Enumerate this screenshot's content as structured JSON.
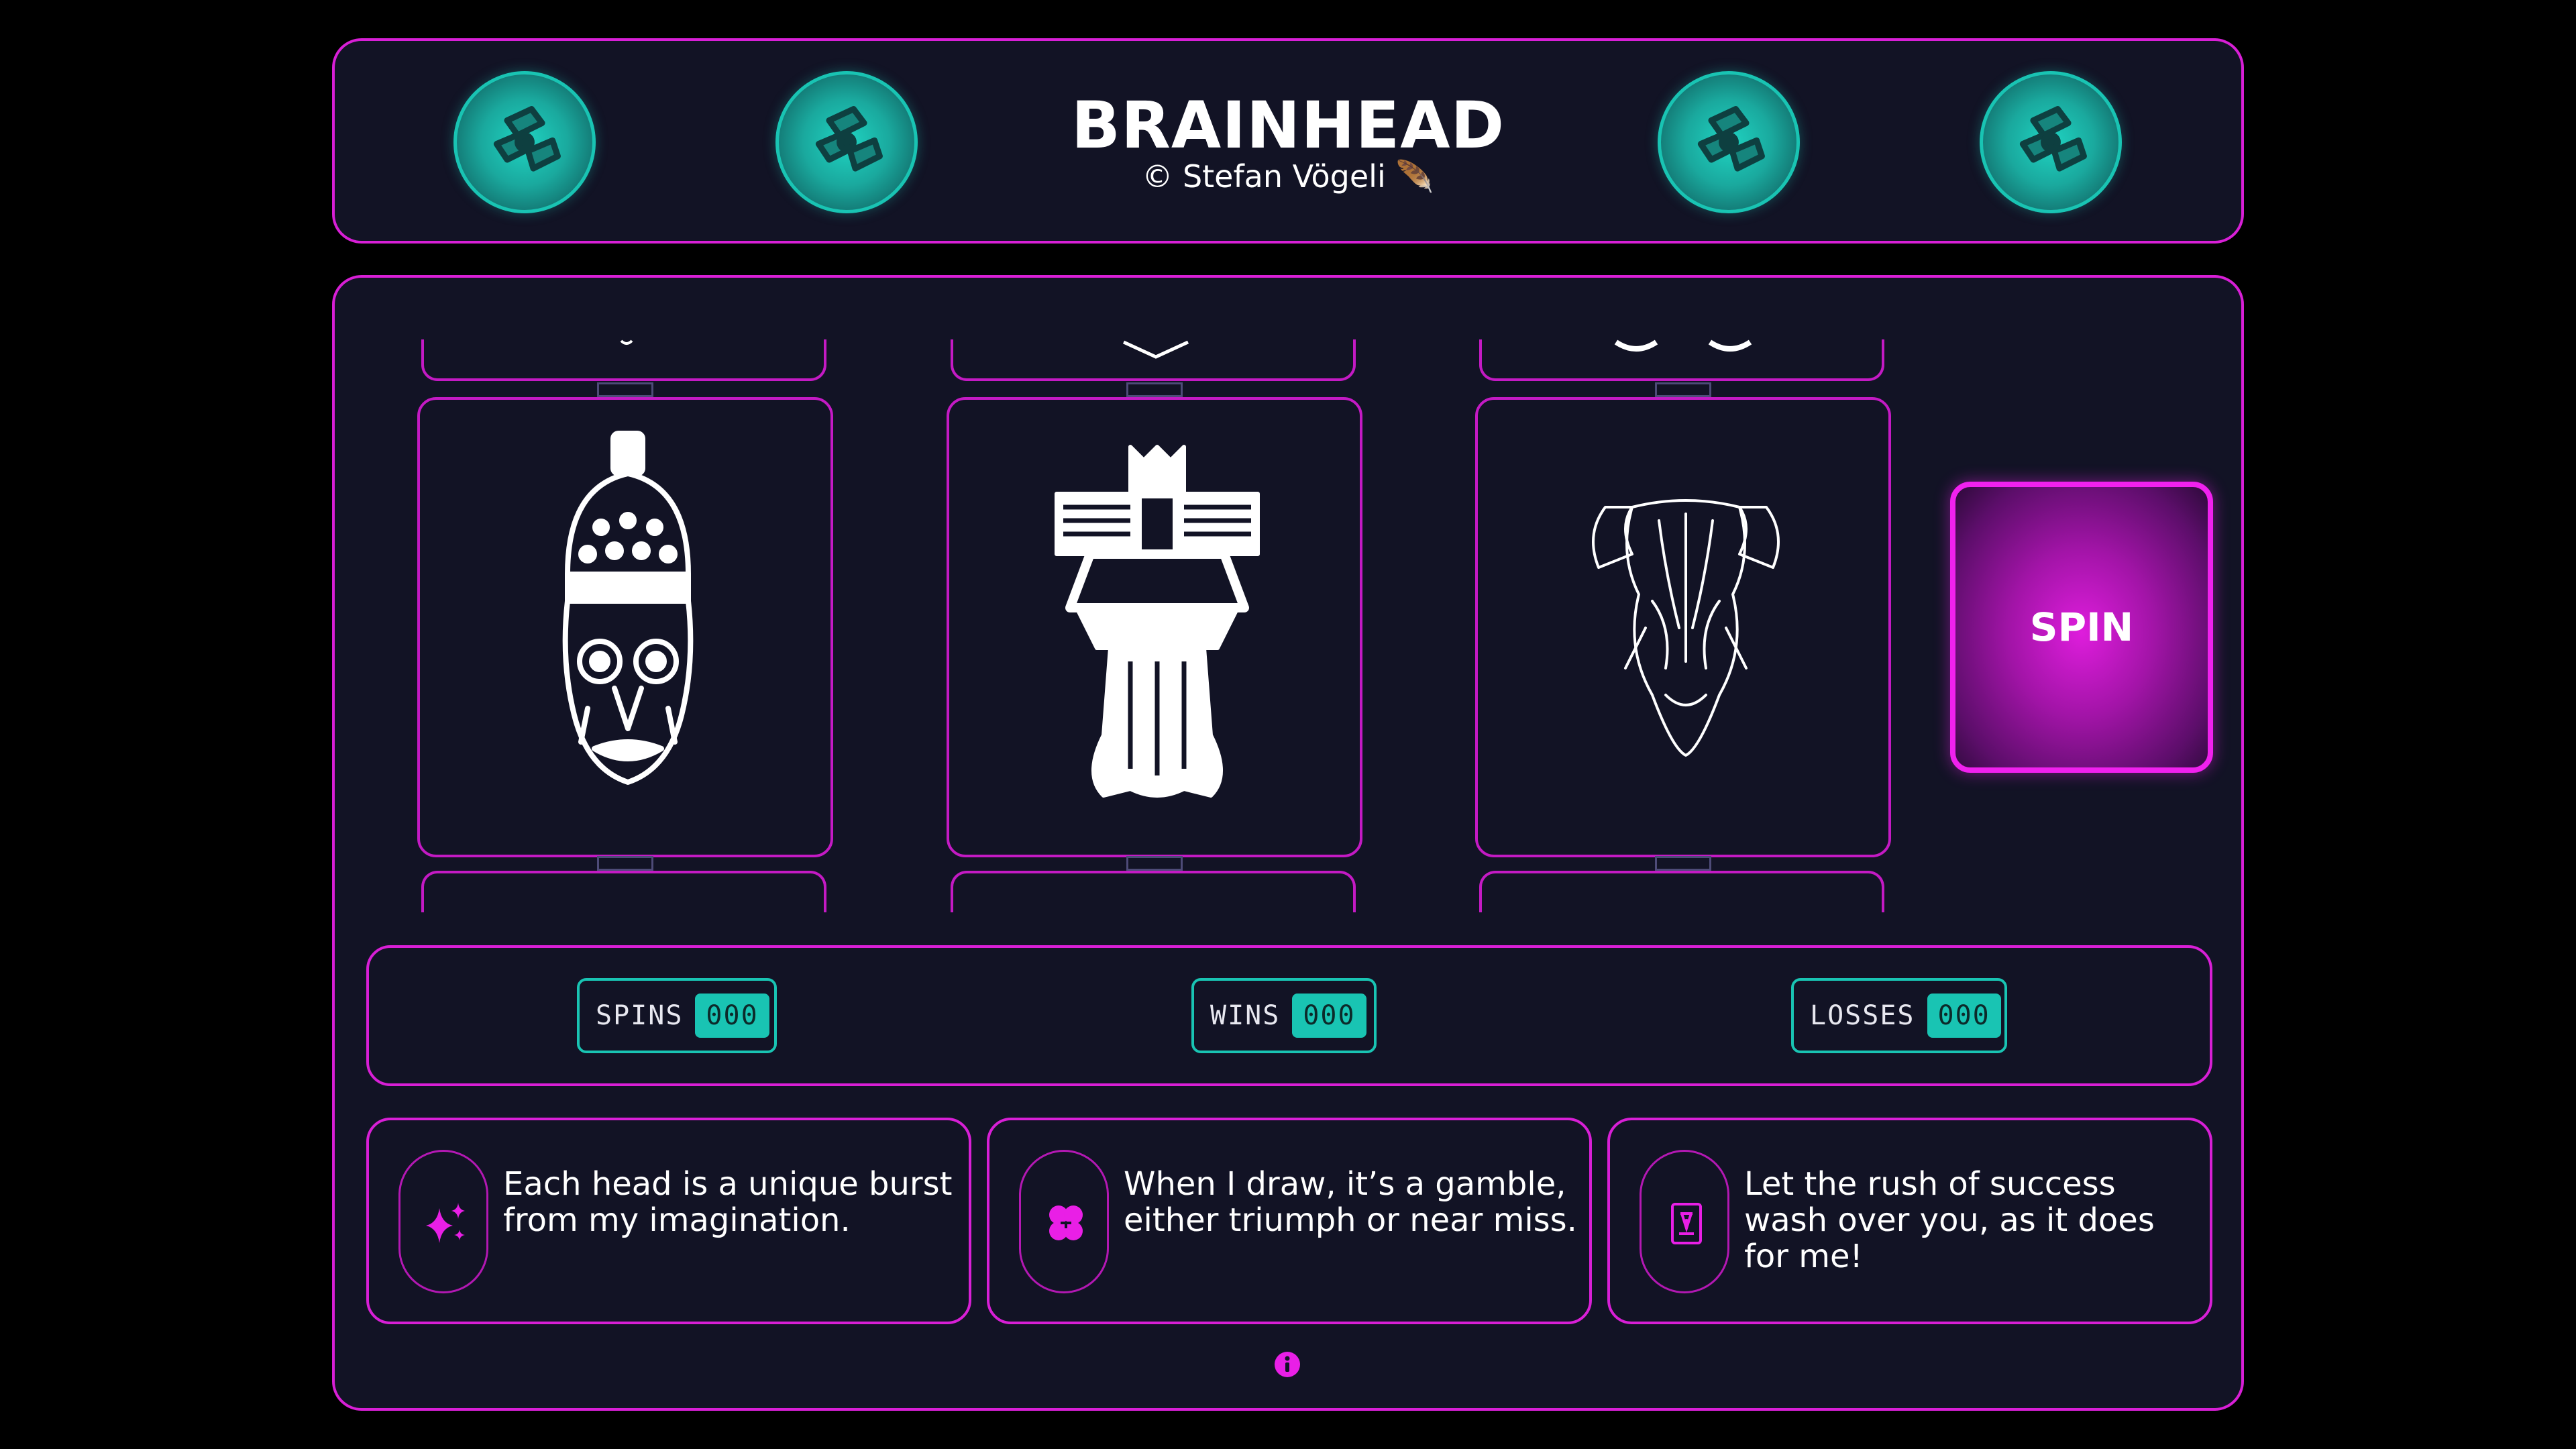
{
  "header": {
    "title": "BRAINHEAD",
    "credit": "© Stefan Vögeli 🪶",
    "coin_icon": "money-stack-icon"
  },
  "spin": {
    "label": "SPIN"
  },
  "stats": {
    "spins": {
      "label": "SPINS",
      "value": "000"
    },
    "wins": {
      "label": "WINS",
      "value": "000"
    },
    "losses": {
      "label": "LOSSES",
      "value": "000"
    }
  },
  "quotes": [
    {
      "text": "Each head is a unique burst from my imagination.",
      "icon": "sparkles-icon"
    },
    {
      "text": "When I draw, it’s a gamble, either triumph or near miss.",
      "icon": "clover-icon"
    },
    {
      "text": "Let the rush of success wash over you, as it does for me!",
      "icon": "card-icon"
    }
  ],
  "colors": {
    "background": "#000000",
    "panel": "#121325",
    "accent_magenta": "#d81fd6",
    "accent_teal": "#19c4b3"
  }
}
